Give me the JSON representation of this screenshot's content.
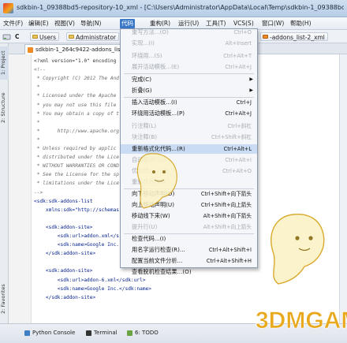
{
  "window": {
    "title": "sdkbin-1_09388bd5-repository-10_xml - [C:\\Users\\Administrator\\AppData\\Local\\Temp\\sdkbin-1_09388bd5-reposi"
  },
  "menubar": {
    "items": [
      "文件(F)",
      "编辑(E)",
      "视图(V)",
      "导航(N)",
      "代码",
      "重构(R)",
      "运行(U)",
      "工具(T)",
      "VCS(S)",
      "窗口(W)",
      "帮助(H)"
    ]
  },
  "navbar": {
    "drive": "C",
    "crumbs": [
      "Users",
      "Administrator",
      "-addons_list-2_xml"
    ]
  },
  "left_strip": {
    "tabs": [
      "1: Project",
      "2: Structure",
      "2: Favorites"
    ]
  },
  "editor_tabs": [
    "sdkbin-1_264c9422-addons_list"
  ],
  "code": {
    "lines": [
      "<?xml version=\"1.0\" encoding",
      "<!--",
      " * Copyright (C) 2012 The And",
      " *",
      " * Licensed under the Apache",
      " * you may not use this file",
      " * You may obtain a copy of t",
      " *",
      " *      http://www.apache.org",
      " *",
      " * Unless required by applic",
      " * distributed under the Lice",
      " * WITHOUT WARRANTIES OR COND",
      " * See the License for the sp",
      " * limitations under the Lice",
      "-->",
      "<sdk:sdk-addons-list",
      "    xmlns:sdk=\"http://schemas",
      "",
      "    <sdk:addon-site>",
      "        <sdk:url>addon.xml</s",
      "        <sdk:name>Google Inc.",
      "    </sdk:addon-site>",
      "",
      "    <sdk:addon-site>",
      "        <sdk:url>addon-6.xml</sdk:url>",
      "        <sdk:name>Google Inc.</sdk:name>",
      "    </sdk:addon-site>"
    ]
  },
  "dropdown": {
    "items": [
      {
        "label": "重写方法...(O)",
        "shortcut": "Ctrl+O"
      },
      {
        "label": "实现...(I)",
        "shortcut": "Alt+Insert"
      },
      {
        "label": "环绕用...(S)",
        "shortcut": "Ctrl+Alt+T"
      },
      {
        "label": "展开活动模板...(E)",
        "shortcut": "Ctrl+Alt+J"
      },
      {
        "label": "完成(C)",
        "shortcut": ""
      },
      {
        "label": "折叠(G)",
        "shortcut": ""
      },
      {
        "label": "插入活动模板...(I)",
        "shortcut": "Ctrl+J"
      },
      {
        "label": "环绕用活动模板...(P)",
        "shortcut": "Ctrl+Alt+J"
      },
      {
        "label": "行注释(L)",
        "shortcut": "Ctrl+斜杠"
      },
      {
        "label": "块注释(B)",
        "shortcut": "Ctrl+Shift+斜杠"
      },
      {
        "label": "重新格式化代码...(R)",
        "shortcut": "Ctrl+Alt+L"
      },
      {
        "label": "自动缩进行(I)",
        "shortcut": "Ctrl+Alt+I"
      },
      {
        "label": "优化导入...(Z)",
        "shortcut": "Ctrl+Alt+O"
      },
      {
        "label": "重新排列代码",
        "shortcut": ""
      },
      {
        "label": "向下移动声明(D)",
        "shortcut": "Ctrl+Shift+向下箭头"
      },
      {
        "label": "向上移动声明(U)",
        "shortcut": "Ctrl+Shift+向上箭头"
      },
      {
        "label": "移动线下来(W)",
        "shortcut": "Alt+Shift+向下箭头"
      },
      {
        "label": "提升行(U)",
        "shortcut": "Alt+Shift+向上箭头"
      },
      {
        "label": "检查代码...(I)",
        "shortcut": ""
      },
      {
        "label": "用名字运行检查(R)...",
        "shortcut": "Ctrl+Alt+Shift+I"
      },
      {
        "label": "配置当前文件分析...",
        "shortcut": "Ctrl+Alt+Shift+H"
      },
      {
        "label": "查看脱机检查结果...(O)",
        "shortcut": ""
      }
    ]
  },
  "bottom_tabs": [
    "Python Console",
    "Terminal",
    "6: TODO"
  ],
  "watermark": {
    "text": "3DMGAME"
  },
  "colors": {
    "menu_active": "#3b78c8",
    "watermark_gold": "#e9a91f"
  }
}
